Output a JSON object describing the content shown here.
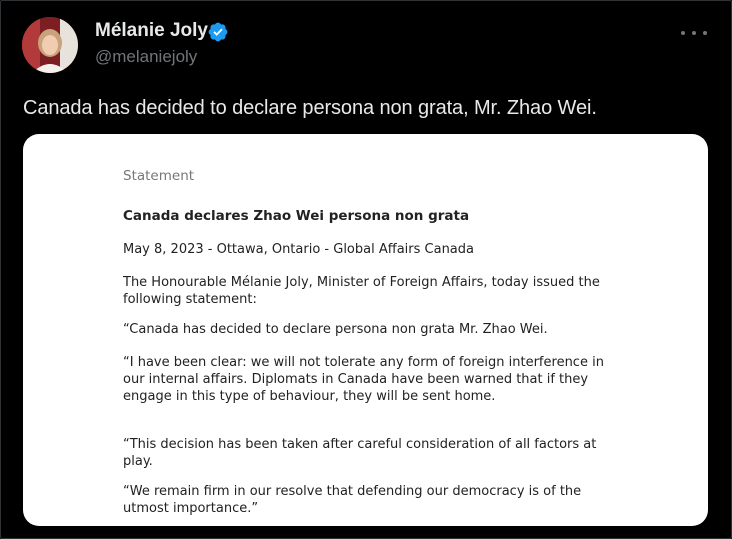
{
  "tweet": {
    "author_name": "Mélanie Joly",
    "handle": "@melaniejoly",
    "text": "Canada has decided to declare persona non grata, Mr. Zhao Wei.",
    "verified_icon": "verified-badge-icon",
    "more_icon": "more-options-icon"
  },
  "statement": {
    "label": "Statement",
    "title": "Canada declares Zhao Wei persona non grata",
    "dateline": "May 8, 2023 - Ottawa, Ontario - Global Affairs Canada",
    "paragraphs": [
      "The Honourable Mélanie Joly, Minister of Foreign Affairs, today issued the following statement:",
      "“Canada has decided to declare persona non grata Mr. Zhao Wei.",
      "“I have been clear: we will not tolerate any form of foreign interference in our internal affairs. Diplomats in Canada have been warned that if they engage in this type of behaviour, they will be sent home.",
      "“This decision has been taken after careful consideration of all factors at play.",
      "“We remain firm in our resolve that defending our democracy is of the utmost importance.”"
    ]
  },
  "colors": {
    "background": "#000000",
    "primary_text": "#e7e9ea",
    "secondary_text": "#71767b",
    "verified_blue": "#1d9bf0"
  }
}
